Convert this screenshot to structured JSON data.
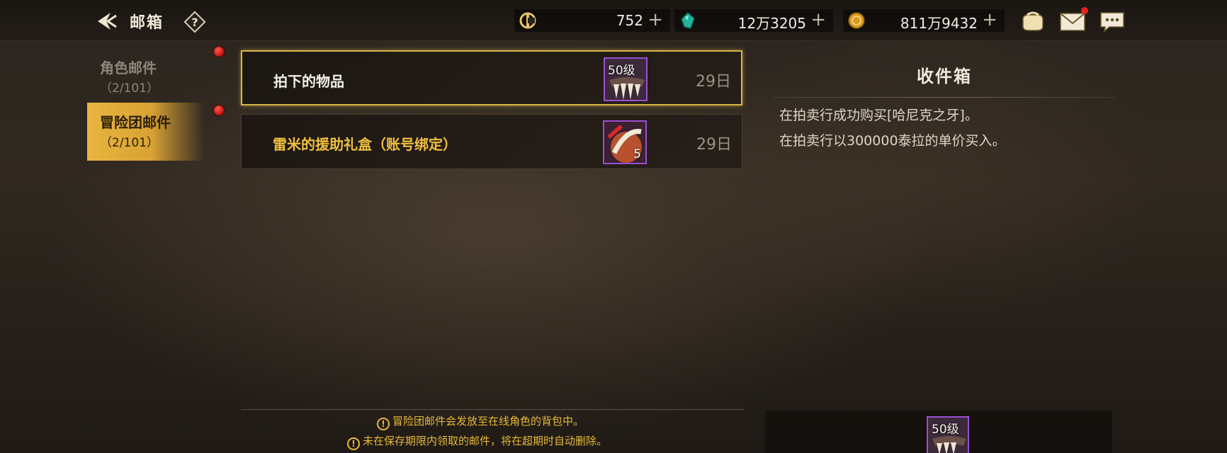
{
  "header": {
    "title": "邮箱",
    "back_icon": "back-arrow-icon",
    "help_icon": "help-icon"
  },
  "currencies": [
    {
      "icon": "tera-coin-icon",
      "value": "752",
      "plus": "+"
    },
    {
      "icon": "gem-icon",
      "value": "12万3205",
      "plus": "+"
    },
    {
      "icon": "gold-coin-icon",
      "value": "811万9432",
      "plus": "+"
    }
  ],
  "top_icons": [
    "pouch-icon",
    "mail-icon",
    "chat-icon"
  ],
  "sidebar": {
    "items": [
      {
        "label": "角色邮件",
        "count": "（2/101）",
        "active": false
      },
      {
        "label": "冒险团邮件",
        "count": "（2/101）",
        "active": true
      }
    ]
  },
  "mails": [
    {
      "subject": "拍下的物品",
      "date": "29日",
      "item_level": "50级",
      "item_qty": ""
    },
    {
      "subject": "雷米的援助礼盒（账号绑定）",
      "date": "29日",
      "item_level": "",
      "item_qty": "5"
    }
  ],
  "detail": {
    "title": "收件箱",
    "lines": [
      "在拍卖行成功购买[哈尼克之牙]。",
      "在拍卖行以300000泰拉的单价买入。"
    ],
    "attachment_level": "50级"
  },
  "notices": [
    "冒险团邮件会发放至在线角色的背包中。",
    "未在保存期限内领取的邮件，将在超期时自动删除。"
  ],
  "colors": {
    "accent_gold": "#e8b53f",
    "notice_text": "#e8b938",
    "notification_red": "#e2231a",
    "item_border_epic": "#9b4fd0"
  }
}
